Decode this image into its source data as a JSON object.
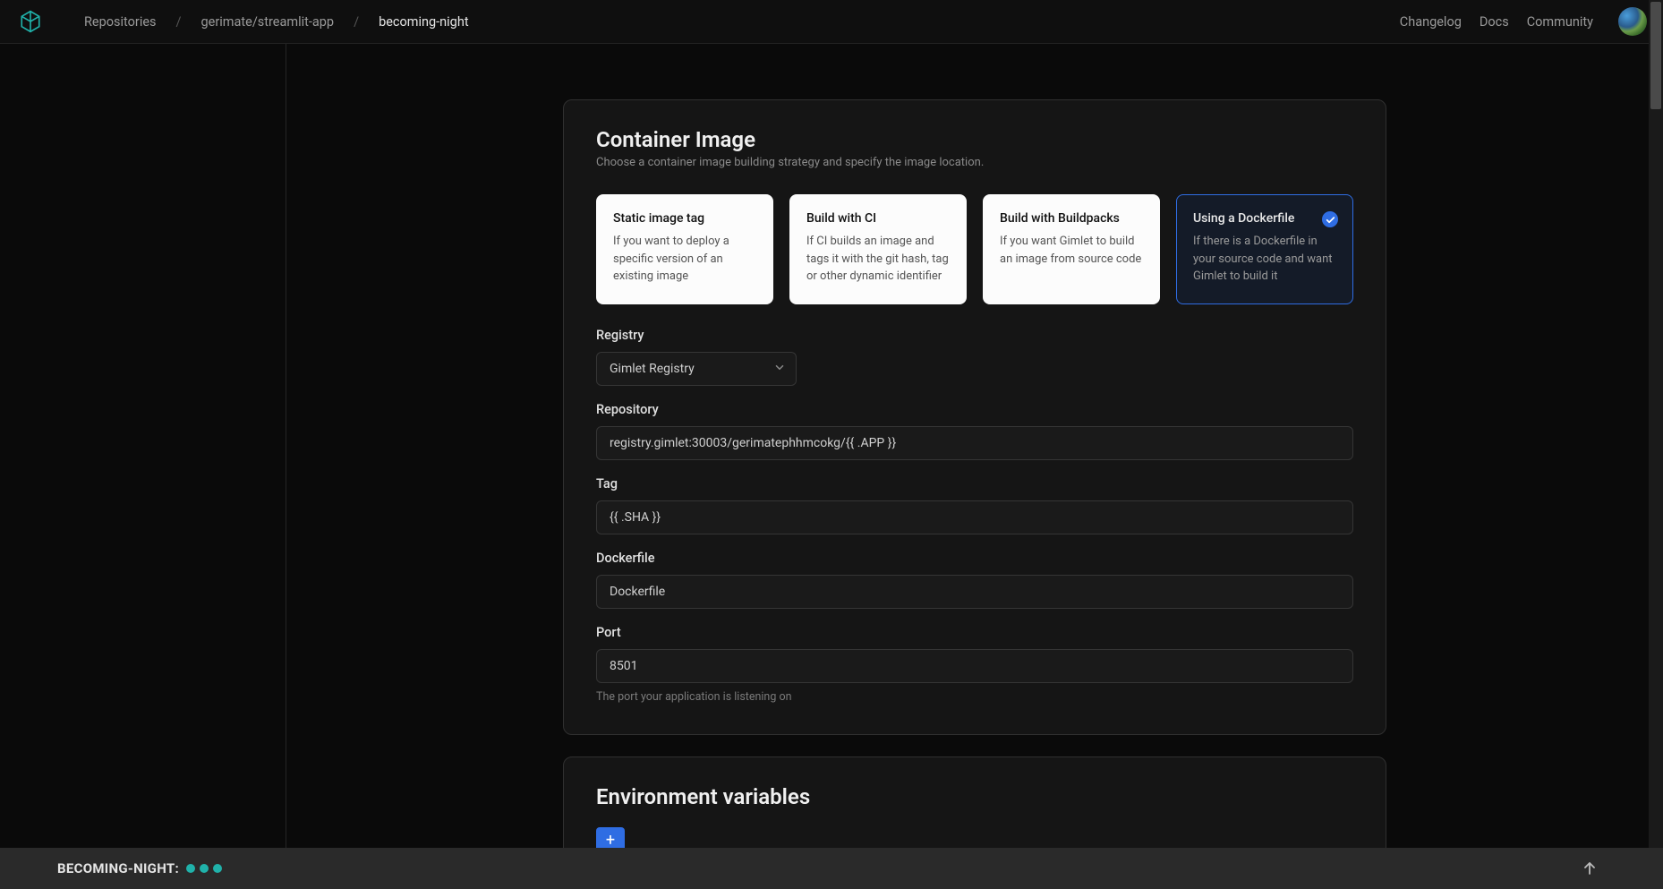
{
  "breadcrumbs": {
    "root": "Repositories",
    "repo": "gerimate/streamlit-app",
    "current": "becoming-night"
  },
  "toplinks": {
    "changelog": "Changelog",
    "docs": "Docs",
    "community": "Community"
  },
  "container": {
    "title": "Container Image",
    "subtitle": "Choose a container image building strategy and specify the image location.",
    "options": [
      {
        "title": "Static image tag",
        "desc": "If you want to deploy a specific version of an existing image"
      },
      {
        "title": "Build with CI",
        "desc": "If CI builds an image and tags it with the git hash, tag or other dynamic identifier"
      },
      {
        "title": "Build with Buildpacks",
        "desc": "If you want Gimlet to build an image from source code"
      },
      {
        "title": "Using a Dockerfile",
        "desc": "If there is a Dockerfile in your source code and want Gimlet to build it"
      }
    ],
    "registry_label": "Registry",
    "registry_value": "Gimlet Registry",
    "repository_label": "Repository",
    "repository_value": "registry.gimlet:30003/gerimatephhmcokg/{{ .APP }}",
    "tag_label": "Tag",
    "tag_value": "{{ .SHA }}",
    "dockerfile_label": "Dockerfile",
    "dockerfile_value": "Dockerfile",
    "port_label": "Port",
    "port_value": "8501",
    "port_help": "The port your application is listening on"
  },
  "envvars": {
    "title": "Environment variables",
    "add": "+"
  },
  "status": {
    "label": "BECOMING-NIGHT:"
  }
}
